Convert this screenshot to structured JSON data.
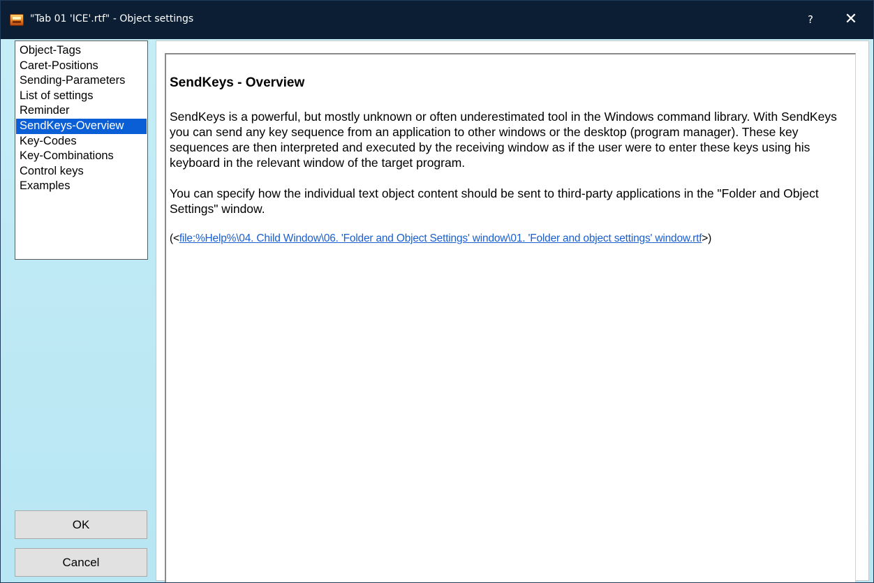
{
  "window": {
    "title": "\"Tab 01 'ICE'.rtf\" - Object settings",
    "help_label": "?",
    "close_label": "✕"
  },
  "sidebar": {
    "items": [
      {
        "label": "Object-Tags"
      },
      {
        "label": "Caret-Positions"
      },
      {
        "label": "Sending-Parameters"
      },
      {
        "label": "List of settings"
      },
      {
        "label": "Reminder"
      },
      {
        "label": "SendKeys-Overview"
      },
      {
        "label": "Key-Codes"
      },
      {
        "label": "Key-Combinations"
      },
      {
        "label": "Control keys"
      },
      {
        "label": "Examples"
      }
    ],
    "selected": "SendKeys-Overview"
  },
  "buttons": {
    "ok": "OK",
    "cancel": "Cancel"
  },
  "document": {
    "heading": "SendKeys - Overview",
    "paragraph1": "SendKeys is a powerful, but mostly unknown or often underestimated tool in the Windows command library. With SendKeys you can send any key sequence from an application to other windows or the desktop (program manager). These key sequences are then interpreted and executed by the receiving window as if the user were to enter these keys using his keyboard in the relevant window of the target program.",
    "paragraph2": "You can specify how the individual text object content should be sent to third-party applications in the \"Folder and Object Settings\" window.",
    "ref_prefix": "(<",
    "ref_link": "file:%Help%\\04. Child Window\\06. 'Folder and Object Settings' window\\01. 'Folder and object settings' window.rtf",
    "ref_suffix": ">)"
  },
  "colors": {
    "titlebar": "#0b1e33",
    "background": "#bfeaf5",
    "selection": "#0a5fd6",
    "link": "#1a5fd0"
  },
  "icons": {
    "app": "app-icon",
    "help": "help-icon",
    "close": "close-icon"
  }
}
